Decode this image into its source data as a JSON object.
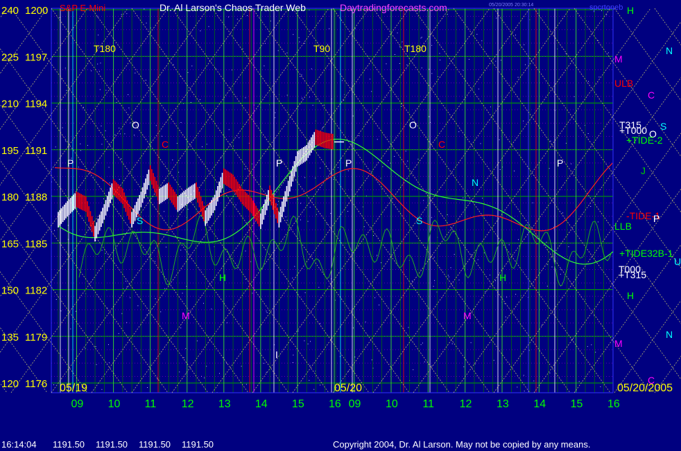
{
  "header": {
    "instrument": "S&P E-Mini",
    "site_title": "Dr. Al Larson's Chaos Trader Web",
    "site_url": "Daytradingforecasts.com",
    "timestamp_small": "05/20/2005 20:30:14",
    "right_label": "spcrtoneb"
  },
  "footer": {
    "time": "16:14:04",
    "open": "1191.50",
    "high": "1191.50",
    "low": "1191.50",
    "close": "1191.50",
    "copyright": "Copyright 2004, Dr. Al Larson. May not be copied by any means."
  },
  "colors": {
    "background": "#000080",
    "price_bars_up": "#ffffff",
    "price_bars_down": "#ff0000",
    "yellow_text": "#ffff00",
    "green_grid": "#00c000",
    "red_line": "#ff0000",
    "green_line": "#33cc33",
    "magenta": "#ff00ff",
    "cyan": "#00ffff"
  },
  "chart_data": {
    "type": "line",
    "title": "S&P E-Mini",
    "y_axis_left": {
      "tick_labels": [
        "240",
        "225",
        "210",
        "195",
        "180",
        "165",
        "150",
        "135",
        "120"
      ],
      "range": [
        120,
        240
      ]
    },
    "y_axis_price": {
      "tick_labels": [
        "1200",
        "1197",
        "1194",
        "1191",
        "1188",
        "1185",
        "1182",
        "1179",
        "1176"
      ],
      "range": [
        1176,
        1200
      ]
    },
    "x_axis": {
      "date_labels": [
        "05/19",
        "05/20",
        "05/20/2005"
      ],
      "hour_ticks_day1": [
        "09",
        "10",
        "11",
        "12",
        "13",
        "14",
        "15",
        "16"
      ],
      "hour_ticks_day2": [
        "09",
        "10",
        "11",
        "12",
        "13",
        "14",
        "15",
        "16"
      ]
    },
    "annotations_top": [
      "T180",
      "T90",
      "T180"
    ],
    "right_labels": [
      {
        "text": "H",
        "color": "#00ff00"
      },
      {
        "text": "N",
        "color": "#00ffff"
      },
      {
        "text": "M",
        "color": "#ff00ff"
      },
      {
        "text": "ULB",
        "color": "#ff0000"
      },
      {
        "text": "C",
        "color": "#ff00ff"
      },
      {
        "text": "T315",
        "color": "#ffffff"
      },
      {
        "text": "+T000",
        "color": "#ffffff"
      },
      {
        "text": "O",
        "color": "#ffffff"
      },
      {
        "text": "S",
        "color": "#00ffff"
      },
      {
        "text": "+TIDE-2",
        "color": "#00ff00"
      },
      {
        "text": "J",
        "color": "#00cc00"
      },
      {
        "text": "P",
        "color": "#ffffff"
      },
      {
        "text": "-TIDE-1",
        "color": "#ff0000"
      },
      {
        "text": "LLB",
        "color": "#00ff00"
      },
      {
        "text": "P",
        "color": "#ffffff"
      },
      {
        "text": "+TIDE32B-1",
        "color": "#00ff00"
      },
      {
        "text": "U",
        "color": "#00ffff"
      },
      {
        "text": "T000",
        "color": "#ffffff"
      },
      {
        "text": "+T315",
        "color": "#ffffff"
      },
      {
        "text": "H",
        "color": "#00ff00"
      },
      {
        "text": "N",
        "color": "#00ffff"
      },
      {
        "text": "M",
        "color": "#ff00ff"
      },
      {
        "text": "C",
        "color": "#ff00ff"
      }
    ],
    "in_chart_labels": [
      "P",
      "O",
      "C",
      "P",
      "H",
      "M",
      "S",
      "P",
      "P",
      "O",
      "C",
      "S",
      "N",
      "H",
      "M",
      "P",
      "I",
      "H"
    ],
    "series": [
      {
        "kind": "price_bars",
        "x_hours": [
          8.5,
          8.75,
          9.0,
          9.25,
          9.5,
          9.75,
          10.0,
          10.25,
          10.5,
          10.75,
          11.0,
          11.25,
          11.5,
          11.75,
          12.0,
          12.25,
          12.5,
          12.75,
          13.0,
          13.25,
          13.5,
          13.75,
          14.0,
          14.25,
          14.5,
          14.75,
          15.0,
          15.25,
          15.5,
          15.75,
          16.0
        ],
        "close": [
          1186.5,
          1187.2,
          1187.8,
          1187.5,
          1185.6,
          1187.0,
          1188.6,
          1188.0,
          1186.5,
          1187.8,
          1189.5,
          1188.0,
          1188.4,
          1187.5,
          1188.0,
          1188.4,
          1186.6,
          1187.6,
          1189.3,
          1188.9,
          1188.0,
          1187.4,
          1186.4,
          1188.2,
          1186.5,
          1188.5,
          1190.4,
          1190.8,
          1191.8,
          1191.6,
          1191.5
        ]
      },
      {
        "kind": "red_cycle"
      },
      {
        "kind": "green_smooth"
      },
      {
        "kind": "green_oscillator"
      }
    ]
  }
}
